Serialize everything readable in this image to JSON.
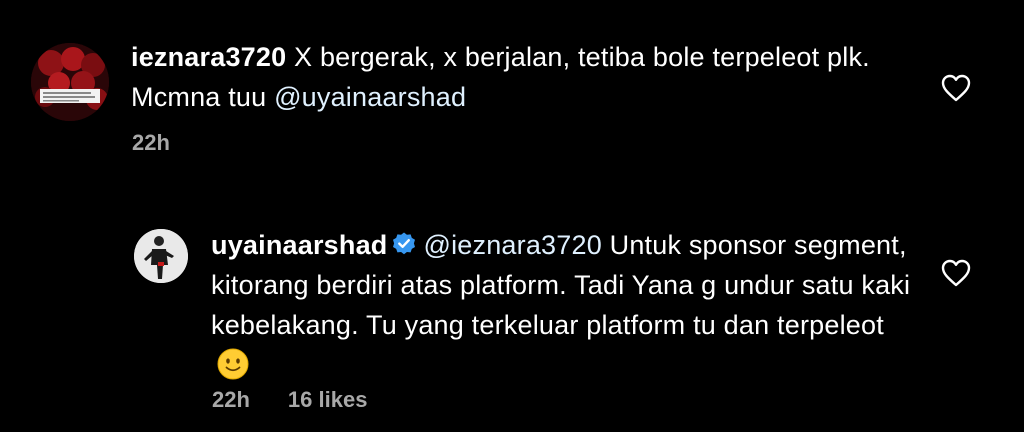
{
  "comments": [
    {
      "username": "ieznara3720",
      "text": " X bergerak, x berjalan, tetiba bole terpeleot plk. Mcmna tuu ",
      "mention": "@uyainaarshad",
      "time": "22h",
      "icon": "heart-outline-icon"
    },
    {
      "username": "uyainaarshad",
      "verified": true,
      "mention": "@ieznara3720",
      "text": " Untuk sponsor segment, kitorang berdiri atas platform. Tadi Yana g undur satu kaki kebelakang. Tu yang terkeluar platform tu dan terpeleot",
      "emoji": "slightly-smiling-face",
      "time": "22h",
      "likes": "16 likes",
      "icon": "heart-outline-icon"
    }
  ],
  "colors": {
    "background": "#000000",
    "text": "#ffffff",
    "meta": "#a8a8a8",
    "verified": "#3797f0"
  }
}
